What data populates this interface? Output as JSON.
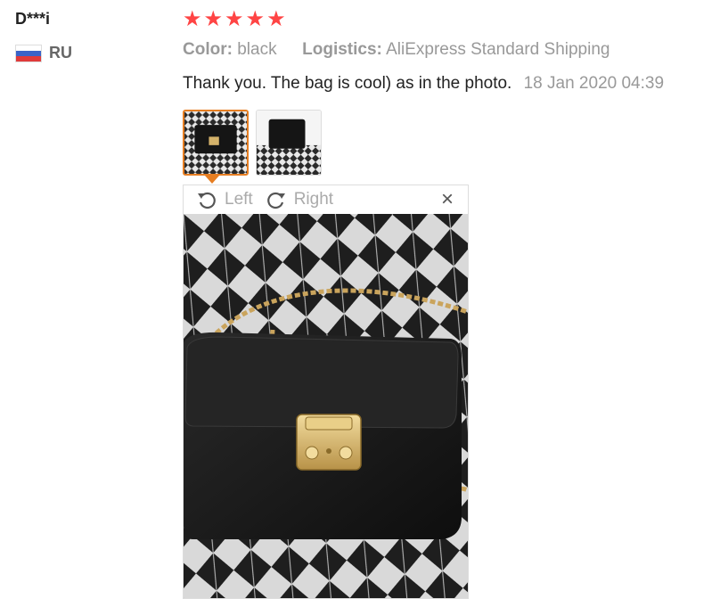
{
  "user": {
    "name": "D***i",
    "country_code": "RU",
    "flag_icon": "russia-flag-icon"
  },
  "rating": {
    "stars": 5,
    "max": 5,
    "color": "#ff4444"
  },
  "meta": {
    "color_label": "Color:",
    "color_value": "black",
    "logistics_label": "Logistics:",
    "logistics_value": "AliExpress Standard Shipping"
  },
  "review": {
    "text": "Thank you. The bag is cool) as in the photo.",
    "date": "18 Jan 2020 04:39"
  },
  "viewer": {
    "left_label": "Left",
    "right_label": "Right",
    "close_symbol": "×"
  },
  "colors": {
    "accent": "#e67e22",
    "muted": "#999999"
  }
}
